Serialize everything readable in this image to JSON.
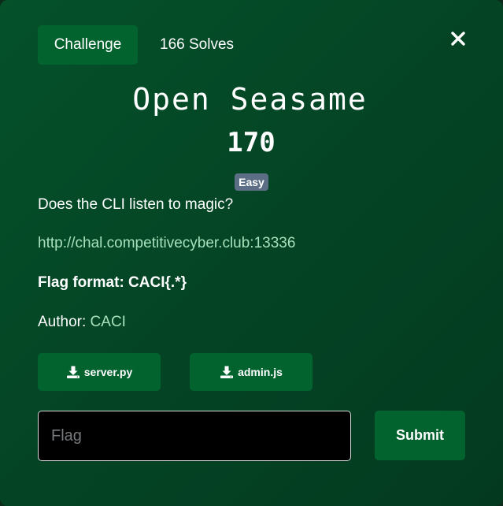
{
  "tabs": {
    "challenge_label": "Challenge",
    "solves_label": "166 Solves"
  },
  "challenge": {
    "name": "Open Seasame",
    "points": "170",
    "difficulty": "Easy",
    "description": "Does the CLI listen to magic?",
    "url": "http://chal.competitivecyber.club:13336",
    "flag_format": "Flag format: CACI{.*}",
    "author_label": "Author: ",
    "author_name": "CACI"
  },
  "files": [
    {
      "name": "server.py",
      "icon": "download-icon"
    },
    {
      "name": "admin.js",
      "icon": "download-icon"
    }
  ],
  "form": {
    "flag_placeholder": "Flag",
    "flag_value": "",
    "submit_label": "Submit"
  },
  "colors": {
    "modal_bg": "#04512a",
    "button_bg": "#03632f",
    "link": "#a7e0bb",
    "badge_bg": "#5b6e85"
  }
}
